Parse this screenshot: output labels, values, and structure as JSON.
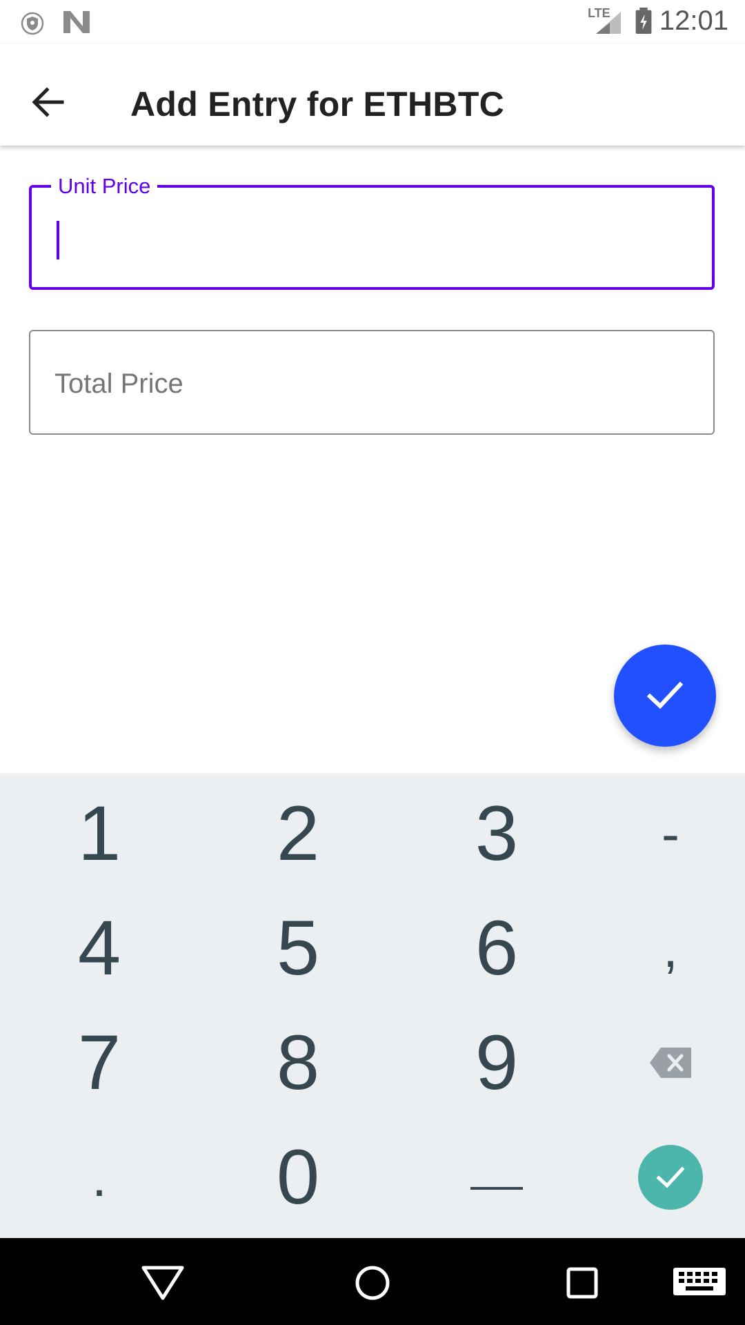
{
  "status_bar": {
    "time": "12:01",
    "network": "LTE",
    "icons": [
      "vpn-shield-icon",
      "n-logo-icon",
      "signal-icon",
      "battery-charging-icon"
    ]
  },
  "app_bar": {
    "title": "Add Entry for ETHBTC",
    "back_icon": "arrow-back-icon"
  },
  "form": {
    "unit_price": {
      "label": "Unit Price",
      "value": "",
      "focused": true
    },
    "total_price": {
      "label": "Total Price",
      "value": ""
    }
  },
  "fab": {
    "icon": "check-icon",
    "color": "#2350ff"
  },
  "keyboard": {
    "rows": [
      [
        "1",
        "2",
        "3",
        "-"
      ],
      [
        "4",
        "5",
        "6",
        ","
      ],
      [
        "7",
        "8",
        "9",
        "backspace"
      ],
      [
        ".",
        "0",
        "_",
        "enter"
      ]
    ],
    "enter_color": "#4db6ac"
  },
  "nav_bar": {
    "buttons": [
      "back-triangle-icon",
      "home-circle-icon",
      "recents-square-icon",
      "keyboard-icon"
    ]
  },
  "colors": {
    "accent": "#6200ee",
    "fab": "#2350ff",
    "keyboard_bg": "#eceff1",
    "key_text": "#37474f"
  }
}
